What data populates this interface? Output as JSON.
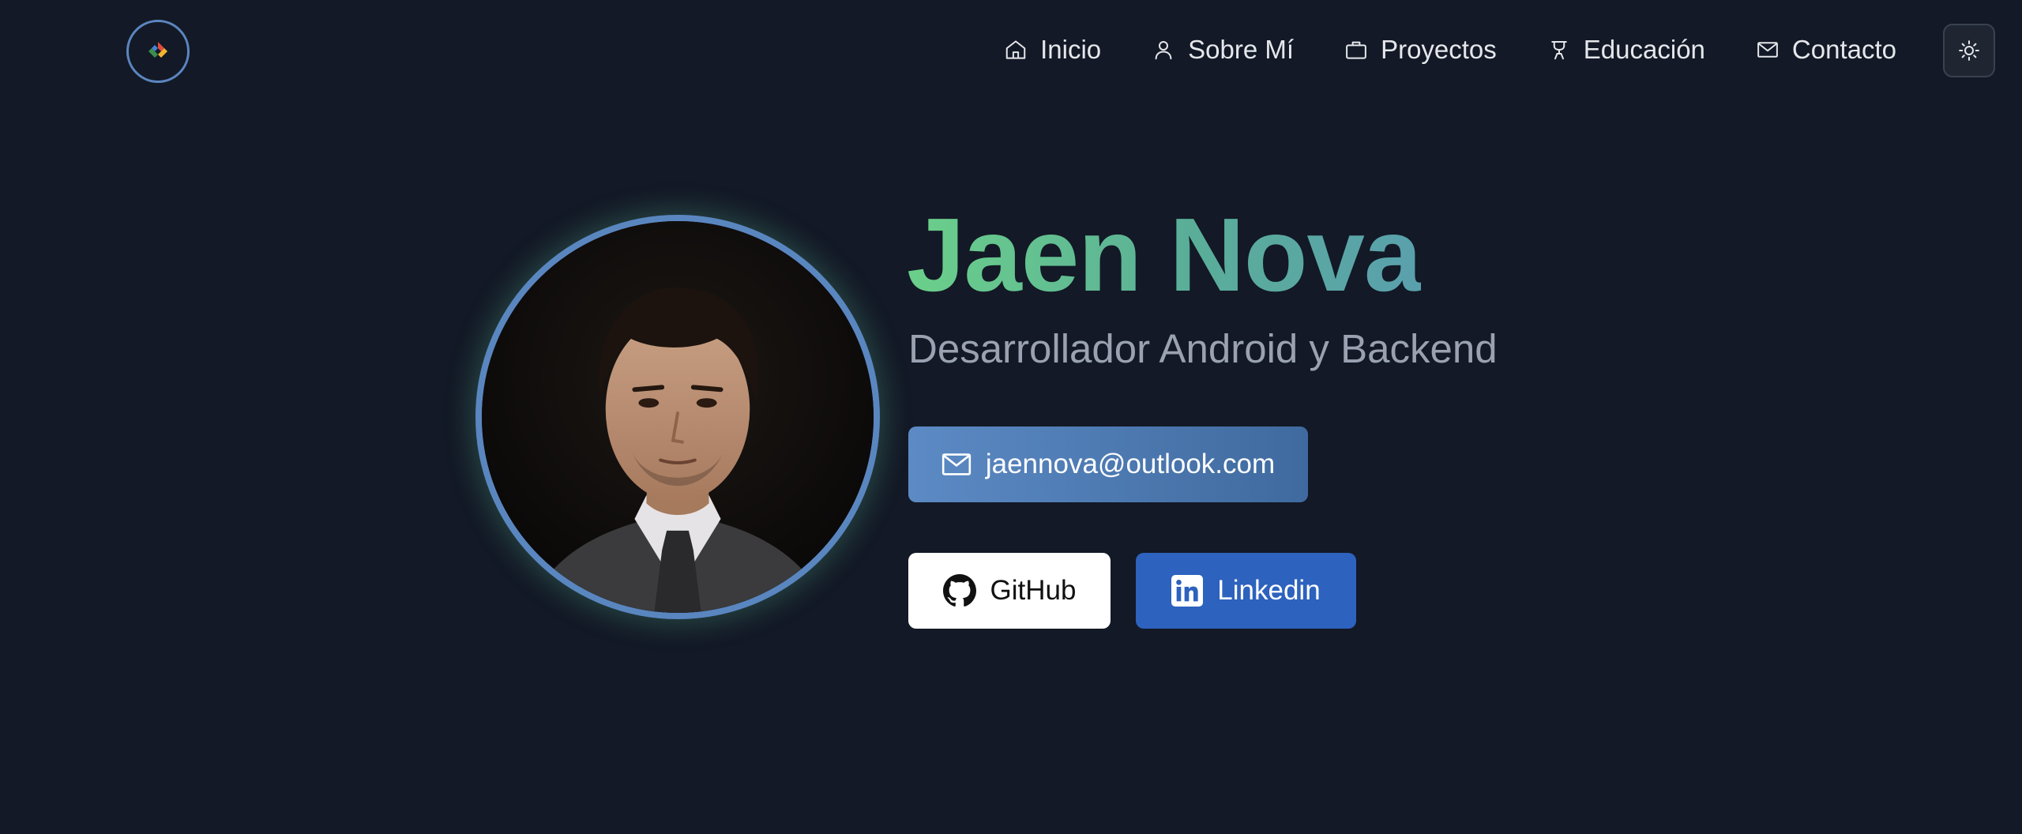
{
  "header": {
    "logo_icon": "colorful-diamond-logo-icon",
    "nav": [
      {
        "label": "Inicio",
        "icon": "home-icon"
      },
      {
        "label": "Sobre Mí",
        "icon": "user-icon"
      },
      {
        "label": "Proyectos",
        "icon": "briefcase-icon"
      },
      {
        "label": "Educación",
        "icon": "graduation-icon"
      },
      {
        "label": "Contacto",
        "icon": "mail-icon"
      }
    ],
    "theme_toggle_icon": "sun-icon"
  },
  "hero": {
    "name": "Jaen Nova",
    "role": "Desarrollador Android y Backend",
    "email_button": "jaennova@outlook.com",
    "github_button": "GitHub",
    "linkedin_button": "Linkedin",
    "avatar": "profile-photo"
  },
  "colors": {
    "background": "#131926",
    "accent_blue": "#5a86c0",
    "name_gradient_start": "#6bd08a",
    "name_gradient_end": "#5aa0ad",
    "linkedin_blue": "#2d62be"
  }
}
